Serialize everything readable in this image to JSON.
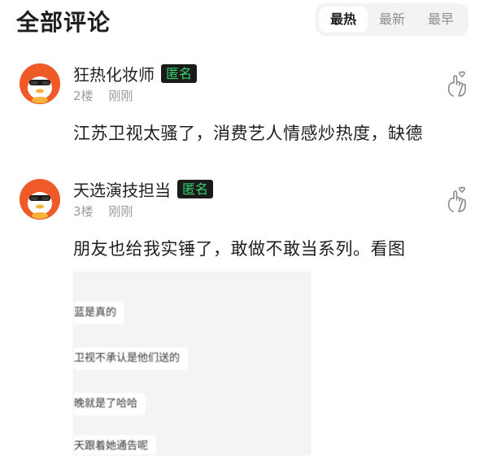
{
  "header": {
    "title": "全部评论",
    "sort_tabs": [
      {
        "label": "最热",
        "active": true
      },
      {
        "label": "最新",
        "active": false
      },
      {
        "label": "最早",
        "active": false
      }
    ]
  },
  "comments": [
    {
      "username": "狂热化妆师",
      "badge": "匿名",
      "floor": "2楼",
      "time": "刚刚",
      "text": "江苏卫视太骚了，消费艺人情感炒热度，缺德",
      "like_icon": "finger-heart-icon"
    },
    {
      "username": "天选演技担当",
      "badge": "匿名",
      "floor": "3楼",
      "time": "刚刚",
      "text": "朋友也给我实锤了，敢做不敢当系列。看图",
      "like_icon": "finger-heart-icon",
      "image_lines": [
        "蓝是真的",
        "卫视不承认是他们送的",
        "晚就是了哈哈",
        "天跟着她通告呢"
      ]
    }
  ],
  "colors": {
    "avatar_bg": "#ee5a28",
    "badge_bg": "#1a1a1a",
    "badge_text": "#34d36b",
    "meta_text": "#9c9c9c"
  }
}
